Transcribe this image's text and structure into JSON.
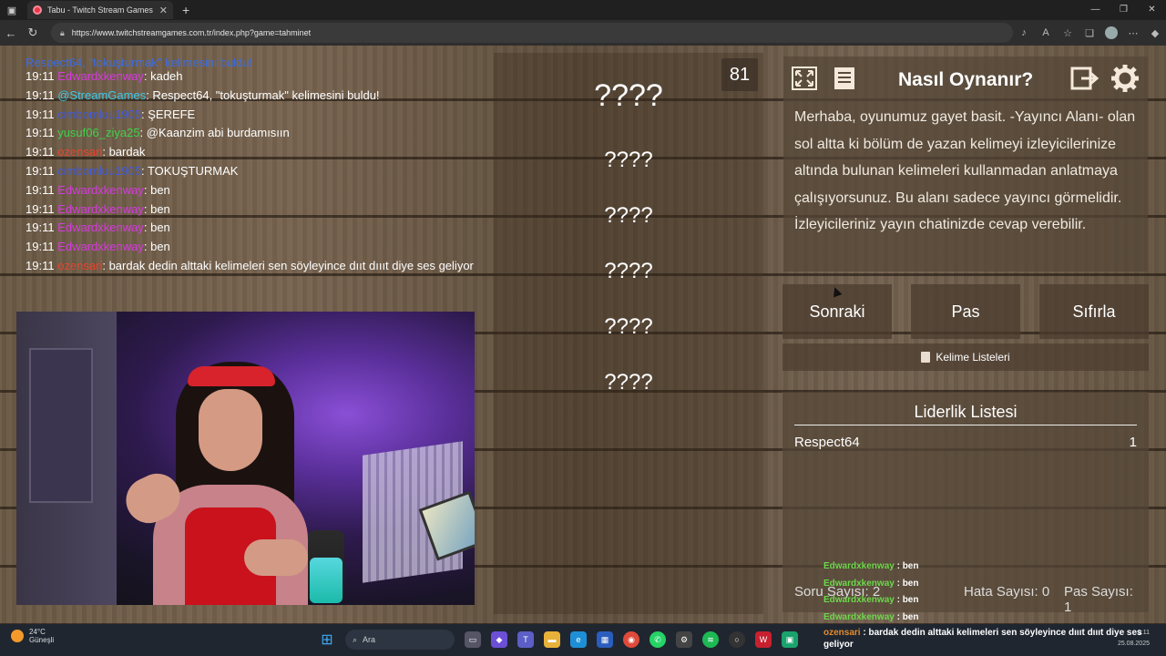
{
  "browser": {
    "tab_title": "Tabu - Twitch Stream Games",
    "url": "https://www.twitchstreamgames.com.tr/index.php?game=tahminet"
  },
  "chat": {
    "first_line": "Respect64, \"tokuşturmak\" kelimesini buldu!",
    "lines": [
      {
        "time": "19:11",
        "user": "Edwardxkenway",
        "color": "#d63ae0",
        "msg": ": kadeh"
      },
      {
        "time": "19:11",
        "user": "@StreamGames",
        "color": "#3ec9e8",
        "msg": ": Respect64, \"tokuşturmak\" kelimesini buldu!"
      },
      {
        "time": "19:11",
        "user": "cimbomluu1905",
        "color": "#3f5ad8",
        "msg": ": ŞEREFE"
      },
      {
        "time": "19:11",
        "user": "yusuf06_ziya25",
        "color": "#3fd34a",
        "msg": ": @Kaanzim abi burdamısıın"
      },
      {
        "time": "19:11",
        "user": "ozensari",
        "color": "#e8452e",
        "msg": ": bardak"
      },
      {
        "time": "19:11",
        "user": "cimbomluu1905",
        "color": "#3f5ad8",
        "msg": ": TOKUŞTURMAK"
      },
      {
        "time": "19:11",
        "user": "Edwardxkenway",
        "color": "#d63ae0",
        "msg": ": ben"
      },
      {
        "time": "19:11",
        "user": "Edwardxkenway",
        "color": "#d63ae0",
        "msg": ": ben"
      },
      {
        "time": "19:11",
        "user": "Edwardxkenway",
        "color": "#d63ae0",
        "msg": ": ben"
      },
      {
        "time": "19:11",
        "user": "Edwardxkenway",
        "color": "#d63ae0",
        "msg": ": ben"
      },
      {
        "time": "19:11",
        "user": "ozensari",
        "color": "#e8452e",
        "msg": ": bardak dedin alttaki kelimeleri sen söyleyince dııt dıııt diye ses geliyor"
      }
    ]
  },
  "game": {
    "counter": "81",
    "words": [
      "????",
      "????",
      "????",
      "????",
      "????",
      "????"
    ]
  },
  "howto": {
    "title": "Nasıl Oynanır?",
    "text": "Merhaba, oyunumuz gayet basit. -Yayıncı Alanı- olan sol altta ki bölüm de yazan kelimeyi izleyicilerinize altında bulunan kelimeleri kullanmadan anlatmaya çalışıyorsunuz. Bu alanı sadece yayıncı görmelidir. İzleyicileriniz yayın chatinizde cevap verebilir."
  },
  "buttons": {
    "next": "Sonraki",
    "pass": "Pas",
    "reset": "Sıfırla",
    "word_lists": "Kelime Listeleri"
  },
  "leaderboard": {
    "title": "Liderlik Listesi",
    "rows": [
      {
        "name": "Respect64",
        "score": "1"
      }
    ],
    "soru": "Soru Sayısı: 2",
    "hata": "Hata Sayısı: 0",
    "pas": "Pas Sayısı: 1"
  },
  "overlay_chat": [
    {
      "user": "Edwardxkenway",
      "msg": " : ben"
    },
    {
      "user": "Edwardxkenway",
      "msg": " : ben"
    },
    {
      "user": "Edwardxkenway",
      "msg": " : ben"
    },
    {
      "user": "Edwardxkenway",
      "msg": " : ben"
    }
  ],
  "overlay_last": {
    "user": "ozensari",
    "msg": " : bardak dedin alttaki kelimeleri sen söyleyince dıııt dıııt diye ses geliyor"
  },
  "taskbar": {
    "temp": "24°C",
    "weather": "Güneşli",
    "search": "Ara",
    "time": "9:11",
    "date": "25.08.2025"
  },
  "colors": {
    "user_green": "#6cd94a",
    "user_orange": "#e48b2e"
  }
}
